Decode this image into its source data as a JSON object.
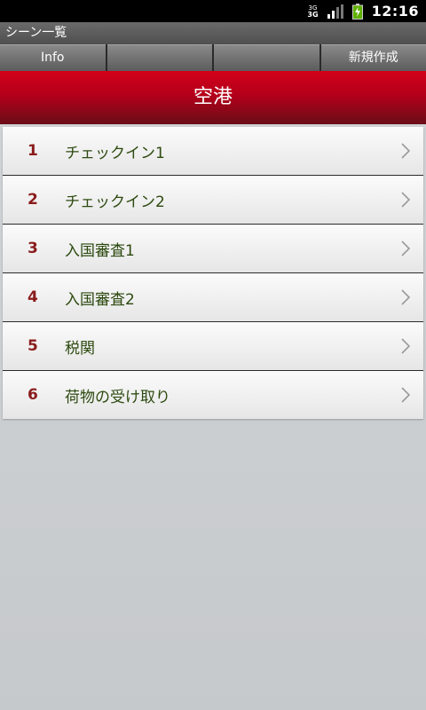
{
  "status_bar": {
    "network_top": "3G",
    "network_label": "3G",
    "time": "12:16"
  },
  "app": {
    "title": "シーン一覧"
  },
  "tabs": [
    {
      "label": "Info"
    },
    {
      "label": ""
    },
    {
      "label": ""
    },
    {
      "label": "新規作成"
    }
  ],
  "header": {
    "title": "空港"
  },
  "scenes": [
    {
      "number": "1",
      "label": "チェックイン1"
    },
    {
      "number": "2",
      "label": "チェックイン2"
    },
    {
      "number": "3",
      "label": "入国審査1"
    },
    {
      "number": "4",
      "label": "入国審査2"
    },
    {
      "number": "5",
      "label": "税関"
    },
    {
      "number": "6",
      "label": "荷物の受け取り"
    }
  ],
  "colors": {
    "header_red": "#c4001a",
    "number_red": "#8a1c1c",
    "label_green": "#2d4a10"
  },
  "icons": {
    "row_arrow": "chevron-right-icon",
    "signal": "signal-icon",
    "battery": "battery-icon"
  }
}
